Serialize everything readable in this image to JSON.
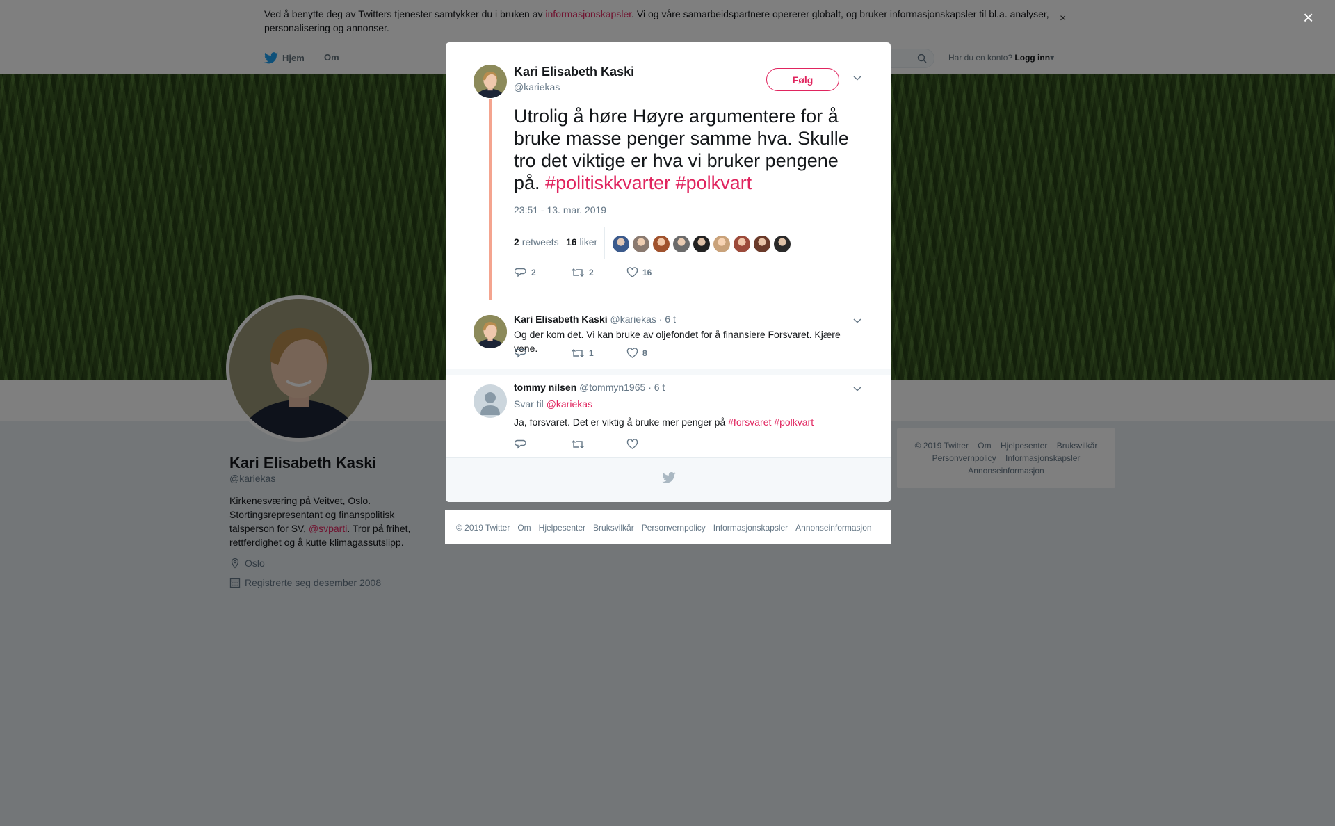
{
  "cookie": {
    "text_before": "Ved å benytte deg av Twitters tjenester samtykker du i bruken av ",
    "link": "informasjonskapsler",
    "text_after": ". Vi og våre samarbeidspartnere opererer globalt, og bruker informasjonskapsler til bl.a. analyser, personalisering og annonser.",
    "close": "×"
  },
  "nav": {
    "home": "Hjem",
    "about": "Om",
    "login_prompt": "Har du en konto?",
    "login": "Logg inn"
  },
  "profile": {
    "name": "Kari Elisabeth Kaski",
    "handle": "@kariekas",
    "bio_before": "Kirkenesværing på Veitvet, Oslo. Stortingsrepresentant og finanspolitisk talsperson for SV, ",
    "bio_mention": "@svparti",
    "bio_after": ". Tror på frihet, rettferdighet og å kutte klimagassutslipp.",
    "location": "Oslo",
    "joined": "Registrerte seg desember 2008"
  },
  "side_footer": {
    "items": [
      "© 2019 Twitter",
      "Om",
      "Hjelpesenter",
      "Bruksvilkår",
      "Personvernpolicy",
      "Informasjonskapsler",
      "Annonseinformasjon"
    ]
  },
  "overlay_close": "×",
  "main_tweet": {
    "name": "Kari Elisabeth Kaski",
    "handle": "@kariekas",
    "follow": "Følg",
    "text": "Utrolig å høre Høyre argumentere for å bruke masse penger samme hva. Skulle tro det viktige er hva vi bruker pengene på. ",
    "hashtag1": "#politiskkvarter",
    "hashtag2": "#polkvart",
    "time": "23:51 - 13. mar. 2019",
    "retweets_count": "2",
    "retweets_label": "retweets",
    "likes_count": "16",
    "likes_label": "liker",
    "likers": [
      "#3b5a8c",
      "#8a7a70",
      "#a0522d",
      "#6b6b6b",
      "#222222",
      "#c9a27a",
      "#9c4a3a",
      "#6a3a2a",
      "#2a2a2a"
    ],
    "actions": {
      "replies": "2",
      "retweets": "2",
      "likes": "16"
    }
  },
  "replies": [
    {
      "name": "Kari Elisabeth Kaski",
      "handle": "@kariekas",
      "age": "· 6 t",
      "text": "Og der kom det. Vi kan bruke av oljefondet for å finansiere Forsvaret. Kjære vene.",
      "actions": {
        "replies": "",
        "retweets": "1",
        "likes": "8"
      }
    },
    {
      "name": "tommy nilsen",
      "handle": "@tommyn1965",
      "age": "· 6 t",
      "reply_to_label": "Svar til",
      "reply_to": "@kariekas",
      "text": "Ja, forsvaret. Det er viktig å bruke mer penger på ",
      "hashtag1": "#forsvaret",
      "hashtag2": "#polkvart",
      "actions": {
        "replies": "",
        "retweets": "",
        "likes": ""
      }
    }
  ],
  "modal_footer": {
    "items": [
      "© 2019 Twitter",
      "Om",
      "Hjelpesenter",
      "Bruksvilkår",
      "Personvernpolicy",
      "Informasjonskapsler",
      "Annonseinformasjon"
    ]
  },
  "colors": {
    "accent": "#e0245e",
    "thread": "#f4a48f",
    "muted": "#657786"
  }
}
